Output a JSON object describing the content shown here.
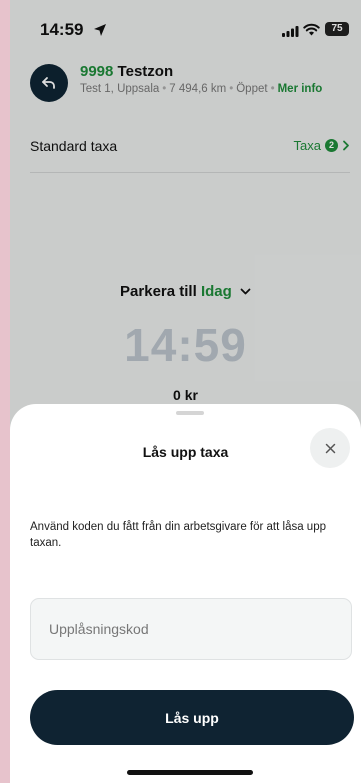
{
  "status_bar": {
    "time": "14:59",
    "battery": "75"
  },
  "zone": {
    "number": "9998",
    "name": "Testzon",
    "address": "Test 1, Uppsala",
    "distance": "7 494,6 km",
    "state": "Öppet",
    "more_info": "Mer info"
  },
  "tariff": {
    "label": "Standard taxa",
    "link": "Taxa",
    "count": "2"
  },
  "parking": {
    "until_label": "Parkera till",
    "day": "Idag",
    "time": "14:59",
    "price": "0 kr"
  },
  "sheet": {
    "title": "Lås upp taxa",
    "description": "Använd koden du fått från din arbetsgivare för att låsa upp taxan.",
    "input_placeholder": "Upplåsningskod",
    "button_label": "Lås upp"
  },
  "colors": {
    "accent": "#1e8a3a",
    "dark": "#0f2332"
  }
}
